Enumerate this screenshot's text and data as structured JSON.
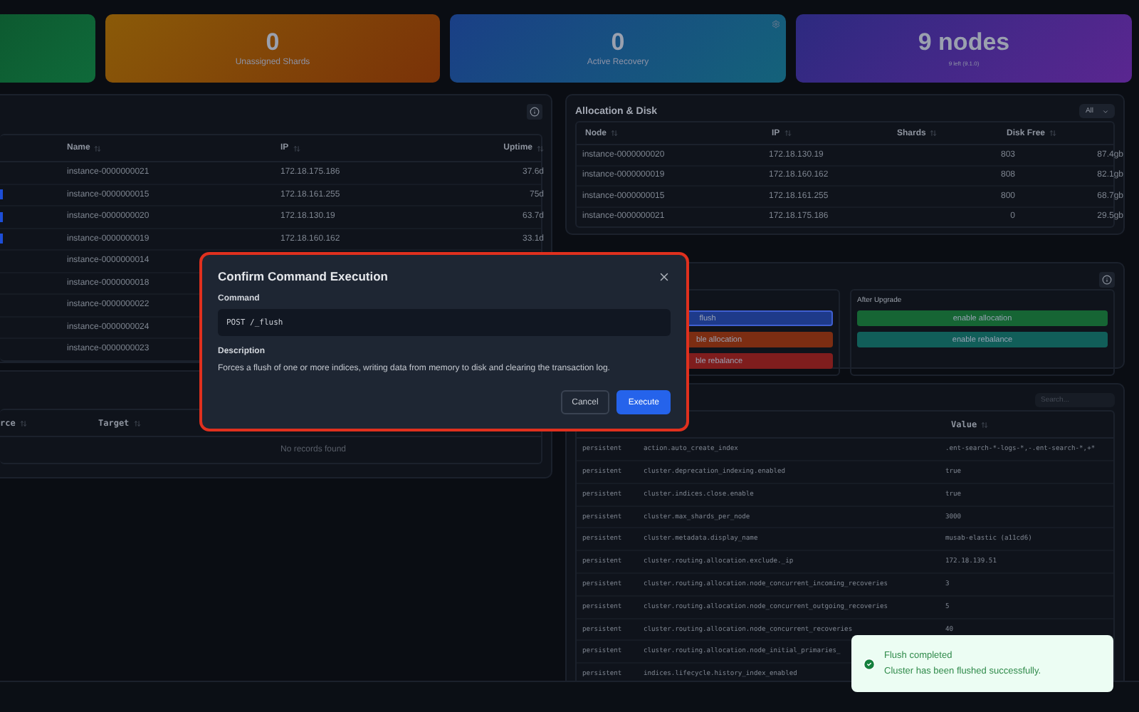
{
  "stats": [
    {
      "kind": "green"
    },
    {
      "kind": "orange",
      "value": "0",
      "label": "Unassigned Shards"
    },
    {
      "kind": "blue",
      "value": "0",
      "label": "Active Recovery",
      "gear": true
    },
    {
      "kind": "purple",
      "value": "9 nodes",
      "label": "9 left (9.1.0)"
    }
  ],
  "nodes_table": {
    "columns": [
      "Name",
      "IP",
      "Uptime"
    ],
    "rows": [
      {
        "badge": false,
        "name": "instance-0000000021",
        "ip": "172.18.175.186",
        "uptime": "37.6d"
      },
      {
        "badge": true,
        "name": "instance-0000000015",
        "ip": "172.18.161.255",
        "uptime": "75d"
      },
      {
        "badge": true,
        "name": "instance-0000000020",
        "ip": "172.18.130.19",
        "uptime": "63.7d"
      },
      {
        "badge": true,
        "name": "instance-0000000019",
        "ip": "172.18.160.162",
        "uptime": "33.1d"
      },
      {
        "badge": false,
        "name": "instance-0000000014"
      },
      {
        "badge": false,
        "name": "instance-0000000018"
      },
      {
        "badge": false,
        "name": "instance-0000000022"
      },
      {
        "badge": false,
        "name": "instance-0000000024"
      },
      {
        "badge": false,
        "name": "instance-0000000023"
      }
    ]
  },
  "allocation": {
    "title": "Allocation & Disk",
    "filter": "All",
    "columns": [
      "Node",
      "IP",
      "Shards",
      "Disk Free"
    ],
    "rows": [
      [
        "instance-0000000020",
        "172.18.130.19",
        "803",
        "87.4gb"
      ],
      [
        "instance-0000000019",
        "172.18.160.162",
        "808",
        "82.1gb"
      ],
      [
        "instance-0000000015",
        "172.18.161.255",
        "800",
        "68.7gb"
      ],
      [
        "instance-0000000021",
        "172.18.175.186",
        "0",
        "29.5gb"
      ]
    ]
  },
  "upgrade": {
    "before": [
      {
        "label": "flush",
        "color": "#1e3a8a",
        "selected": true
      },
      {
        "label": "ble allocation",
        "color": "#7c2d12",
        "selected": false
      },
      {
        "label": "ble rebalance",
        "color": "#7f1d1d",
        "selected": false
      }
    ],
    "after_title": "After Upgrade",
    "after": [
      {
        "label": "enable allocation",
        "color": "#166534",
        "selected": false
      },
      {
        "label": "enable rebalance",
        "color": "#115e59",
        "selected": false
      }
    ]
  },
  "recovery_table": {
    "columns": [
      "rce",
      "Target"
    ],
    "empty": "No records found"
  },
  "settings": {
    "search_placeholder": "Search...",
    "columns": [
      "Value"
    ],
    "rows": [
      {
        "type": "persistent",
        "key": "action.auto_create_index",
        "value": ".ent-search-*-logs-*,-.ent-search-*,+*"
      },
      {
        "type": "persistent",
        "key": "cluster.deprecation_indexing.enabled",
        "value": "true"
      },
      {
        "type": "persistent",
        "key": "cluster.indices.close.enable",
        "value": "true"
      },
      {
        "type": "persistent",
        "key": "cluster.max_shards_per_node",
        "value": "3000"
      },
      {
        "type": "persistent",
        "key": "cluster.metadata.display_name",
        "value": "musab-elastic (a11cd6)"
      },
      {
        "type": "persistent",
        "key": "cluster.routing.allocation.exclude._ip",
        "value": "172.18.139.51"
      },
      {
        "type": "persistent",
        "key": "cluster.routing.allocation.node_concurrent_incoming_recoveries",
        "value": "3"
      },
      {
        "type": "persistent",
        "key": "cluster.routing.allocation.node_concurrent_outgoing_recoveries",
        "value": "5"
      },
      {
        "type": "persistent",
        "key": "cluster.routing.allocation.node_concurrent_recoveries",
        "value": "40"
      },
      {
        "type": "persistent",
        "key": "cluster.routing.allocation.node_initial_primaries_"
      },
      {
        "type": "persistent",
        "key": "indices.lifecycle.history_index_enabled"
      }
    ]
  },
  "dialog": {
    "title": "Confirm Command Execution",
    "command_label": "Command",
    "command": "POST /_flush",
    "description_label": "Description",
    "description": "Forces a flush of one or more indices, writing data from memory to disk and clearing the transaction log.",
    "buttons": [
      {
        "label": "Cancel",
        "kind": "secondary"
      },
      {
        "label": "Execute",
        "kind": "primary"
      }
    ]
  },
  "toast": {
    "title": "Flush completed",
    "message": "Cluster has been flushed successfully."
  }
}
